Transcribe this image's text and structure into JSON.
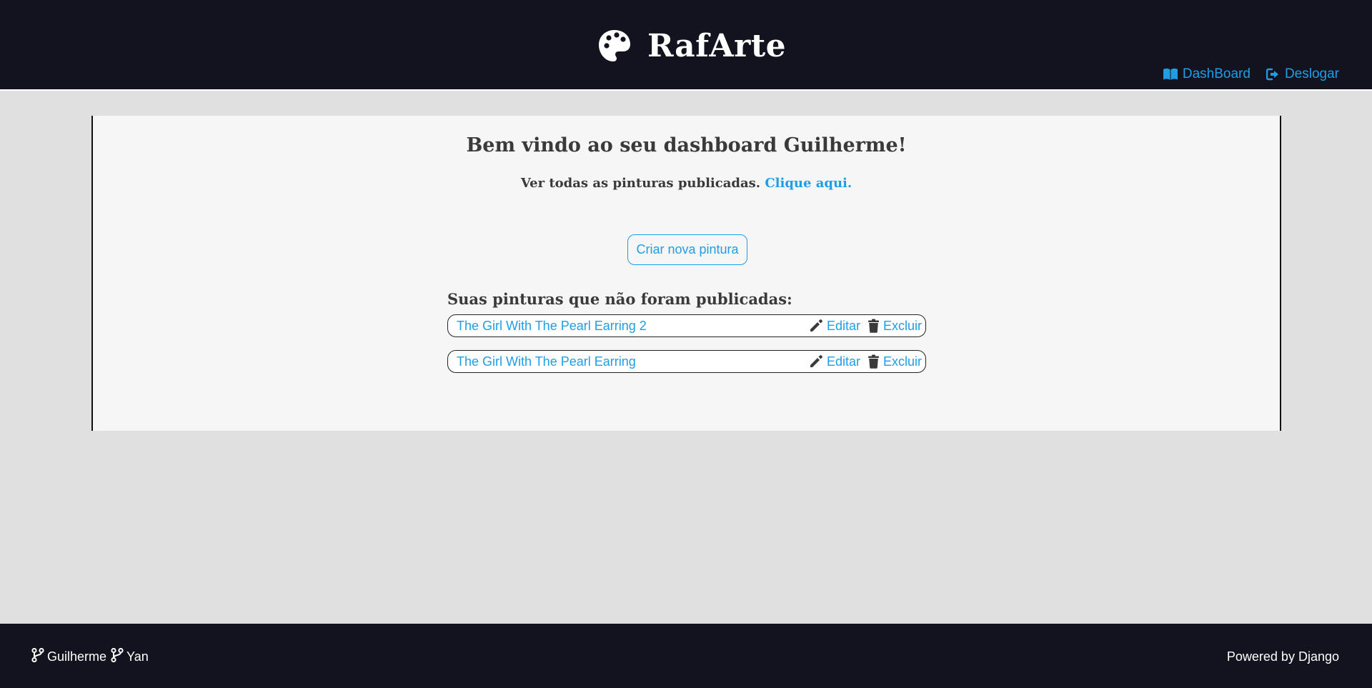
{
  "header": {
    "brand_title": "RafArte",
    "brand_icon": "palette-icon",
    "nav": [
      {
        "label": "DashBoard",
        "icon": "book-open-icon"
      },
      {
        "label": "Deslogar",
        "icon": "sign-out-icon"
      }
    ]
  },
  "main": {
    "welcome": "Bem vindo ao seu dashboard Guilherme!",
    "subline_text": "Ver todas as pinturas publicadas.",
    "subline_link": "Clique aqui.",
    "create_button": "Criar nova pintura",
    "unpublished_title": "Suas pinturas que não foram publicadas:",
    "paintings": [
      {
        "title": "The Girl With The Pearl Earring 2",
        "edit_label": "Editar",
        "delete_label": "Excluir"
      },
      {
        "title": "The Girl With The Pearl Earring",
        "edit_label": "Editar",
        "delete_label": "Excluir"
      }
    ]
  },
  "footer": {
    "authors": [
      {
        "name": "Guilherme",
        "icon": "code-branch-icon"
      },
      {
        "name": "Yan",
        "icon": "code-branch-icon"
      }
    ],
    "powered_by": "Powered by Django"
  },
  "colors": {
    "header_bg": "#13131f",
    "page_bg": "#e0e0e0",
    "panel_bg": "#f6f6f6",
    "link": "#1f9ee6",
    "text": "#3a3a3a"
  }
}
